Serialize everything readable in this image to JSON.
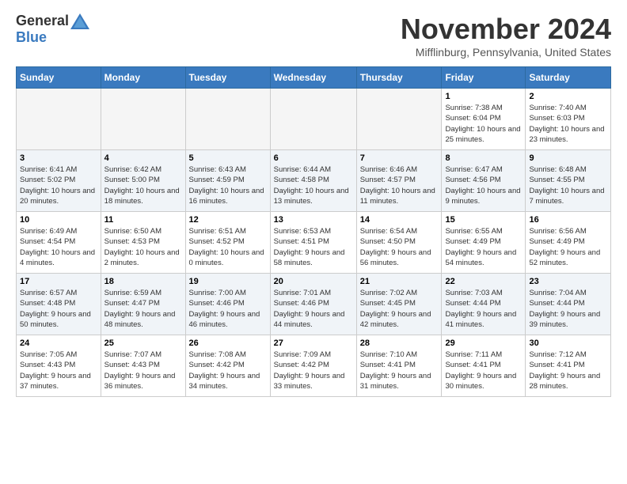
{
  "logo": {
    "general": "General",
    "blue": "Blue"
  },
  "title": "November 2024",
  "location": "Mifflinburg, Pennsylvania, United States",
  "days_of_week": [
    "Sunday",
    "Monday",
    "Tuesday",
    "Wednesday",
    "Thursday",
    "Friday",
    "Saturday"
  ],
  "weeks": [
    [
      {
        "day": "",
        "info": ""
      },
      {
        "day": "",
        "info": ""
      },
      {
        "day": "",
        "info": ""
      },
      {
        "day": "",
        "info": ""
      },
      {
        "day": "",
        "info": ""
      },
      {
        "day": "1",
        "info": "Sunrise: 7:38 AM\nSunset: 6:04 PM\nDaylight: 10 hours and 25 minutes."
      },
      {
        "day": "2",
        "info": "Sunrise: 7:40 AM\nSunset: 6:03 PM\nDaylight: 10 hours and 23 minutes."
      }
    ],
    [
      {
        "day": "3",
        "info": "Sunrise: 6:41 AM\nSunset: 5:02 PM\nDaylight: 10 hours and 20 minutes."
      },
      {
        "day": "4",
        "info": "Sunrise: 6:42 AM\nSunset: 5:00 PM\nDaylight: 10 hours and 18 minutes."
      },
      {
        "day": "5",
        "info": "Sunrise: 6:43 AM\nSunset: 4:59 PM\nDaylight: 10 hours and 16 minutes."
      },
      {
        "day": "6",
        "info": "Sunrise: 6:44 AM\nSunset: 4:58 PM\nDaylight: 10 hours and 13 minutes."
      },
      {
        "day": "7",
        "info": "Sunrise: 6:46 AM\nSunset: 4:57 PM\nDaylight: 10 hours and 11 minutes."
      },
      {
        "day": "8",
        "info": "Sunrise: 6:47 AM\nSunset: 4:56 PM\nDaylight: 10 hours and 9 minutes."
      },
      {
        "day": "9",
        "info": "Sunrise: 6:48 AM\nSunset: 4:55 PM\nDaylight: 10 hours and 7 minutes."
      }
    ],
    [
      {
        "day": "10",
        "info": "Sunrise: 6:49 AM\nSunset: 4:54 PM\nDaylight: 10 hours and 4 minutes."
      },
      {
        "day": "11",
        "info": "Sunrise: 6:50 AM\nSunset: 4:53 PM\nDaylight: 10 hours and 2 minutes."
      },
      {
        "day": "12",
        "info": "Sunrise: 6:51 AM\nSunset: 4:52 PM\nDaylight: 10 hours and 0 minutes."
      },
      {
        "day": "13",
        "info": "Sunrise: 6:53 AM\nSunset: 4:51 PM\nDaylight: 9 hours and 58 minutes."
      },
      {
        "day": "14",
        "info": "Sunrise: 6:54 AM\nSunset: 4:50 PM\nDaylight: 9 hours and 56 minutes."
      },
      {
        "day": "15",
        "info": "Sunrise: 6:55 AM\nSunset: 4:49 PM\nDaylight: 9 hours and 54 minutes."
      },
      {
        "day": "16",
        "info": "Sunrise: 6:56 AM\nSunset: 4:49 PM\nDaylight: 9 hours and 52 minutes."
      }
    ],
    [
      {
        "day": "17",
        "info": "Sunrise: 6:57 AM\nSunset: 4:48 PM\nDaylight: 9 hours and 50 minutes."
      },
      {
        "day": "18",
        "info": "Sunrise: 6:59 AM\nSunset: 4:47 PM\nDaylight: 9 hours and 48 minutes."
      },
      {
        "day": "19",
        "info": "Sunrise: 7:00 AM\nSunset: 4:46 PM\nDaylight: 9 hours and 46 minutes."
      },
      {
        "day": "20",
        "info": "Sunrise: 7:01 AM\nSunset: 4:46 PM\nDaylight: 9 hours and 44 minutes."
      },
      {
        "day": "21",
        "info": "Sunrise: 7:02 AM\nSunset: 4:45 PM\nDaylight: 9 hours and 42 minutes."
      },
      {
        "day": "22",
        "info": "Sunrise: 7:03 AM\nSunset: 4:44 PM\nDaylight: 9 hours and 41 minutes."
      },
      {
        "day": "23",
        "info": "Sunrise: 7:04 AM\nSunset: 4:44 PM\nDaylight: 9 hours and 39 minutes."
      }
    ],
    [
      {
        "day": "24",
        "info": "Sunrise: 7:05 AM\nSunset: 4:43 PM\nDaylight: 9 hours and 37 minutes."
      },
      {
        "day": "25",
        "info": "Sunrise: 7:07 AM\nSunset: 4:43 PM\nDaylight: 9 hours and 36 minutes."
      },
      {
        "day": "26",
        "info": "Sunrise: 7:08 AM\nSunset: 4:42 PM\nDaylight: 9 hours and 34 minutes."
      },
      {
        "day": "27",
        "info": "Sunrise: 7:09 AM\nSunset: 4:42 PM\nDaylight: 9 hours and 33 minutes."
      },
      {
        "day": "28",
        "info": "Sunrise: 7:10 AM\nSunset: 4:41 PM\nDaylight: 9 hours and 31 minutes."
      },
      {
        "day": "29",
        "info": "Sunrise: 7:11 AM\nSunset: 4:41 PM\nDaylight: 9 hours and 30 minutes."
      },
      {
        "day": "30",
        "info": "Sunrise: 7:12 AM\nSunset: 4:41 PM\nDaylight: 9 hours and 28 minutes."
      }
    ]
  ]
}
